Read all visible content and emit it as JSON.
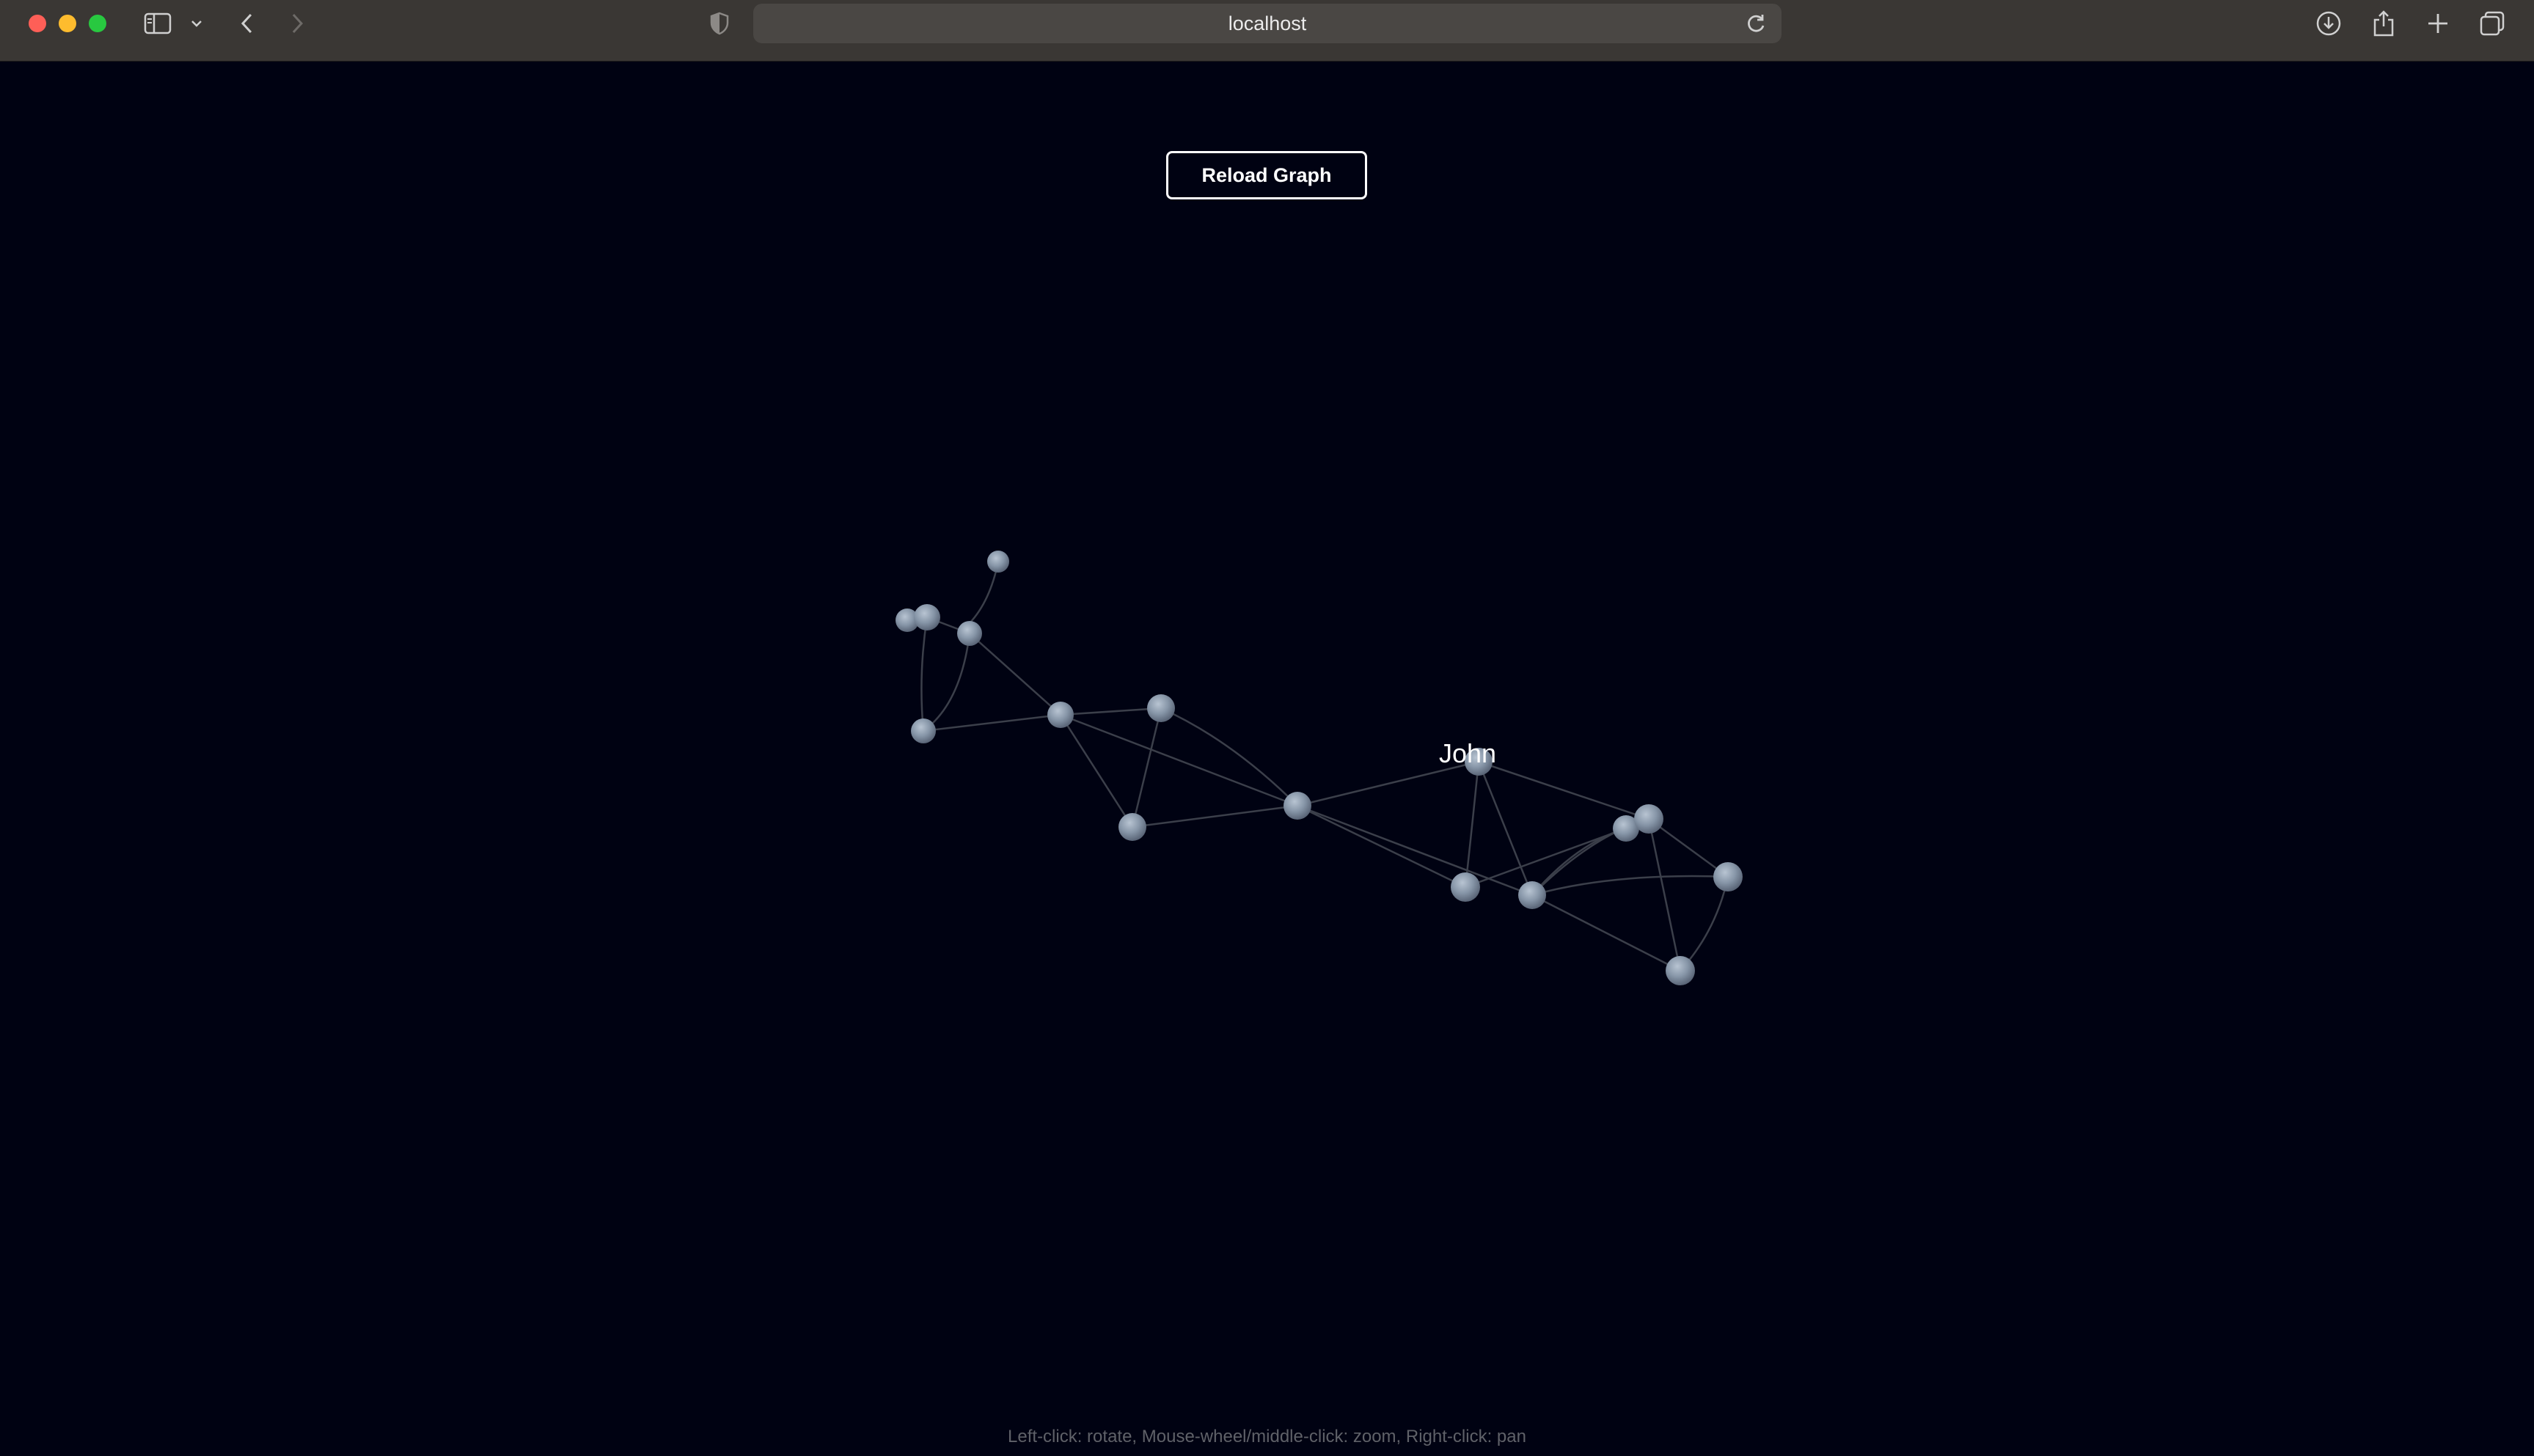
{
  "browser": {
    "address": "localhost"
  },
  "page": {
    "reload_button_label": "Reload Graph",
    "help_text": "Left-click: rotate, Mouse-wheel/middle-click: zoom, Right-click: pan",
    "highlighted_node_label": "John"
  },
  "colors": {
    "background": "#000212",
    "node": "#8a9bb0",
    "link": "#3b3f4a"
  },
  "icons": [
    "sidebar-icon",
    "chevron-down-icon",
    "back-icon",
    "forward-icon",
    "privacy-shield-icon",
    "reload-icon",
    "download-icon",
    "share-icon",
    "new-tab-icon",
    "tab-overview-icon"
  ]
}
